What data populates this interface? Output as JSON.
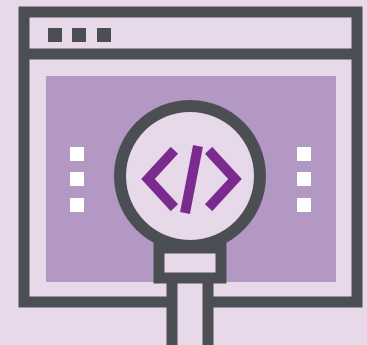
{
  "illustration": {
    "icon_name": "code-inspection-icon",
    "code_symbol": "</>",
    "colors": {
      "background": "#e7d8ea",
      "outline": "#4b4f54",
      "window_fill": "#e7d8ea",
      "content_panel": "#b298c2",
      "lens_fill": "#e7d8ea",
      "code_purple": "#7b2b8e",
      "dot_white": "#ffffff"
    }
  }
}
